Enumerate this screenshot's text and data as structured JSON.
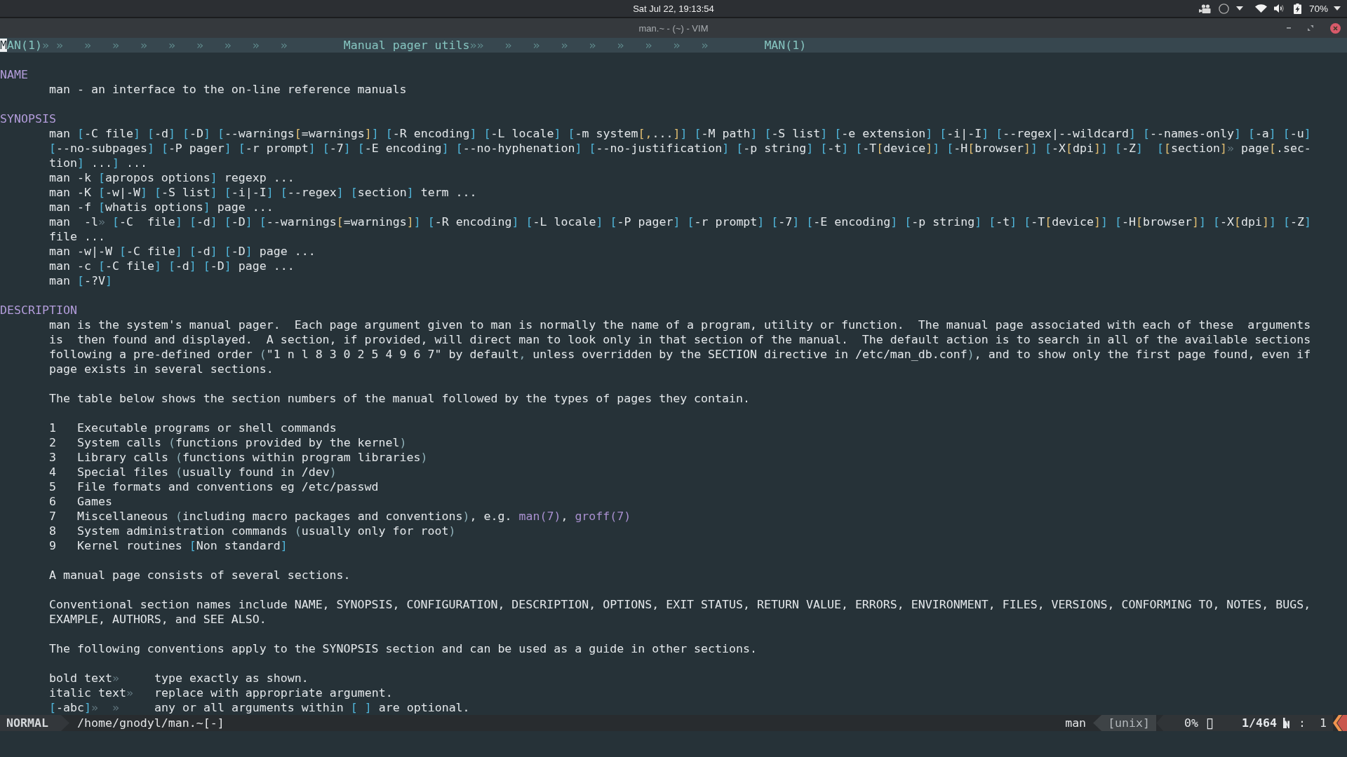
{
  "top_panel": {
    "clock": "Sat Jul 22, 19:13:54",
    "battery": "70%"
  },
  "window": {
    "title": "man.~ - (~) - VIM"
  },
  "header_line": {
    "text": "MAN(1)» »   »   »   »   »   »   »   »   »        Manual pager utils»»   »   »   »   »   »   »   »   »        MAN(1)",
    "cursor": true
  },
  "sections": [
    {
      "heading": "NAME",
      "blocks": [
        {
          "kind": "paragraph",
          "lines": [
            "man - an interface to the on-line reference manuals"
          ]
        }
      ]
    },
    {
      "heading": "SYNOPSIS",
      "blocks": [
        {
          "kind": "synopsis",
          "forms": [
            {
              "lines": [
                "man [-C file] [-d] [-D] [--warnings[=warnings]] [-R encoding] [-L locale] [-m system[,...]] [-M path] [-S list] [-e extension] [-i|-I] [--regex|--wildcard] [--names-only] [-a] [-u]",
                "[--no-subpages] [-P pager] [-r prompt] [-7] [-E encoding] [--no-hyphenation] [--no-justification] [-p string] [-t] [-T[device]] [-H[browser]] [-X[dpi]] [-Z]  [[section]» page[.sec-",
                "tion] ...] ..."
              ]
            },
            {
              "lines": [
                "man -k [apropos options] regexp ..."
              ]
            },
            {
              "lines": [
                "man -K [-w|-W] [-S list] [-i|-I] [--regex] [section] term ..."
              ]
            },
            {
              "lines": [
                "man -f [whatis options] page ..."
              ]
            },
            {
              "lines": [
                "man  -l» [-C  file] [-d] [-D] [--warnings[=warnings]] [-R encoding] [-L locale] [-P pager] [-r prompt] [-7] [-E encoding] [-p string] [-t] [-T[device]] [-H[browser]] [-X[dpi]] [-Z]",
                "file ..."
              ]
            },
            {
              "lines": [
                "man -w|-W [-C file] [-d] [-D] page ..."
              ]
            },
            {
              "lines": [
                "man -c [-C file] [-d] [-D] page ..."
              ]
            },
            {
              "lines": [
                "man [-?V]"
              ]
            }
          ]
        }
      ]
    },
    {
      "heading": "DESCRIPTION",
      "blocks": [
        {
          "kind": "paragraph",
          "lines": [
            "man is the system's manual pager.  Each page argument given to man is normally the name of a program, utility or function.  The manual page associated with each of these  arguments",
            "is  then found and displayed.  A section, if provided, will direct man to look only in that section of the manual.  The default action is to search in all of the available sections",
            "following a pre-defined order (\"1 n l 8 3 0 2 5 4 9 6 7\" by default, unless overridden by the SECTION directive in /etc/man_db.conf), and to show only the first page found, even if",
            "page exists in several sections."
          ]
        },
        {
          "kind": "paragraph",
          "lines": [
            "The table below shows the section numbers of the manual followed by the types of pages they contain."
          ]
        },
        {
          "kind": "list",
          "items": [
            {
              "number": "1",
              "segments": [
                {
                  "kind": "plain",
                  "text": "Executable programs or shell commands"
                }
              ]
            },
            {
              "number": "2",
              "segments": [
                {
                  "kind": "plain",
                  "text": "System calls (functions provided by the kernel)"
                }
              ]
            },
            {
              "number": "3",
              "segments": [
                {
                  "kind": "plain",
                  "text": "Library calls (functions within program libraries)"
                }
              ]
            },
            {
              "number": "4",
              "segments": [
                {
                  "kind": "plain",
                  "text": "Special files (usually found in /dev)"
                }
              ]
            },
            {
              "number": "5",
              "segments": [
                {
                  "kind": "plain",
                  "text": "File formats and conventions eg /etc/passwd"
                }
              ]
            },
            {
              "number": "6",
              "segments": [
                {
                  "kind": "plain",
                  "text": "Games"
                }
              ]
            },
            {
              "number": "7",
              "segments": [
                {
                  "kind": "plain",
                  "text": "Miscellaneous (including macro packages and conventions), e.g. "
                },
                {
                  "kind": "reference",
                  "text": "man(7)"
                },
                {
                  "kind": "plain",
                  "text": ", "
                },
                {
                  "kind": "reference",
                  "text": "groff(7)"
                }
              ]
            },
            {
              "number": "8",
              "segments": [
                {
                  "kind": "plain",
                  "text": "System administration commands (usually only for root)"
                }
              ]
            },
            {
              "number": "9",
              "segments": [
                {
                  "kind": "plain",
                  "text": "Kernel routines [Non standard]"
                }
              ]
            }
          ]
        },
        {
          "kind": "paragraph",
          "lines": [
            "A manual page consists of several sections."
          ]
        },
        {
          "kind": "paragraph",
          "lines": [
            "Conventional section names include NAME, SYNOPSIS, CONFIGURATION, DESCRIPTION, OPTIONS, EXIT STATUS, RETURN VALUE, ERRORS, ENVIRONMENT, FILES, VERSIONS, CONFORMING TO, NOTES, BUGS,",
            "EXAMPLE, AUTHORS, and SEE ALSO."
          ]
        },
        {
          "kind": "paragraph",
          "lines": [
            "The following conventions apply to the SYNOPSIS section and can be used as a guide in other sections."
          ]
        },
        {
          "kind": "definitions",
          "items": [
            {
              "term": "bold text»",
              "definition": "type exactly as shown."
            },
            {
              "term": "italic text»",
              "definition": "replace with appropriate argument."
            },
            {
              "term": "[-abc]»  »",
              "definition": "any or all arguments within [ ] are optional."
            }
          ]
        }
      ]
    }
  ],
  "status_line": {
    "mode": "NORMAL",
    "file": "/home/gnodyl/man.~[-]",
    "filetype": "man",
    "fileformat": "[unix]",
    "percent": "0%",
    "glyph": "▯",
    "line": "1/464",
    "column": ":  1"
  }
}
